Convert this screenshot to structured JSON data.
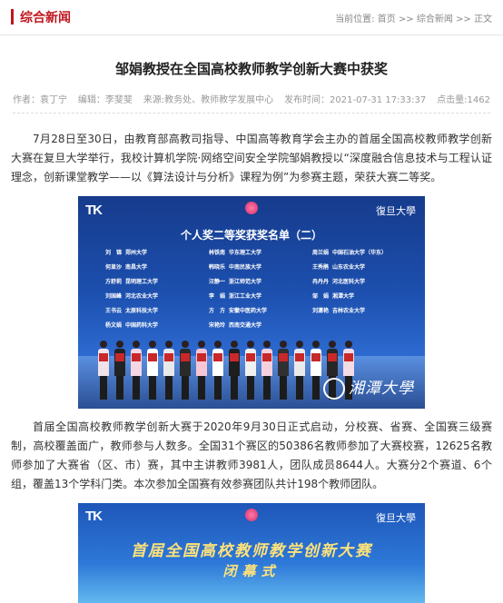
{
  "header": {
    "section_title": "综合新闻",
    "breadcrumb": {
      "prefix": "当前位置: ",
      "home": "首页",
      "separator1": " >> ",
      "section": "综合新闻",
      "separator2": " >> ",
      "current": "正文"
    }
  },
  "article": {
    "title": "邹娟教授在全国高校教师教学创新大赛中获奖",
    "meta": {
      "author": "作者：袁丁宁",
      "editor": "编辑：李斐斐",
      "source": "来源:教务处、教师教学发展中心",
      "date": "发布时间：2021-07-31 17:33:37",
      "clicks": "点击量:1462"
    },
    "paragraph1": "7月28日至30日，由教育部高教司指导、中国高等教育学会主办的首届全国高校教师教学创新大赛在复旦大学举行，我校计算机学院·网络空间安全学院邹娟教授以“深度融合信息技术与工程认证理念，创新课堂教学——以《算法设计与分析》课程为例”为参赛主题，荣获大赛二等奖。",
    "paragraph2": "首届全国高校教师教学创新大赛于2020年9月30日正式启动，分校赛、省赛、全国赛三级赛制，高校覆盖面广，教师参与人数多。全国31个赛区的50386名教师参加了大赛校赛，12625名教师参加了大赛省（区、市）赛，其中主讲教师3981人，团队成员8644人。大赛分2个赛道、6个组，覆盖13个学科门类。本次参加全国赛有效参赛团队共计198个教师团队。"
  },
  "photo1": {
    "logo_left": "TK",
    "logo_right": "復旦大學",
    "screen_title": "个人奖二等奖获奖名单（二）",
    "winners": [
      {
        "name": "刘　锦",
        "school": "郑州大学"
      },
      {
        "name": "林铁南",
        "school": "华东理工大学"
      },
      {
        "name": "周兰娟",
        "school": "中国石油大学（华东）"
      },
      {
        "name": "何显沙",
        "school": "南昌大学"
      },
      {
        "name": "韩晓乐",
        "school": "中南民族大学"
      },
      {
        "name": "王秀鹃",
        "school": "山东农业大学"
      },
      {
        "name": "方舒莉",
        "school": "昆明理工大学"
      },
      {
        "name": "汪静一",
        "school": "浙江师范大学"
      },
      {
        "name": "冉丹丹",
        "school": "河北医科大学"
      },
      {
        "name": "刘国峰",
        "school": "河北农业大学"
      },
      {
        "name": "李　娟",
        "school": "浙江工业大学"
      },
      {
        "name": "邹　娟",
        "school": "湘潭大学"
      },
      {
        "name": "王书云",
        "school": "太原科技大学"
      },
      {
        "name": "方　方",
        "school": "安徽中医药大学"
      },
      {
        "name": "刘潇艳",
        "school": "吉林农业大学"
      },
      {
        "name": "杨文娟",
        "school": "中国药科大学"
      },
      {
        "name": "宋艳玲",
        "school": "西南交通大学"
      },
      {
        "name": "",
        "school": ""
      }
    ],
    "watermark": "湘潭大學"
  },
  "photo2": {
    "logo_left": "TK",
    "logo_right": "復旦大學",
    "banner_title": "首届全国高校教师教学创新大赛",
    "banner_subtitle": "闭幕式"
  },
  "colors": {
    "accent": "#c0161e",
    "text": "#333333",
    "meta": "#999999"
  }
}
